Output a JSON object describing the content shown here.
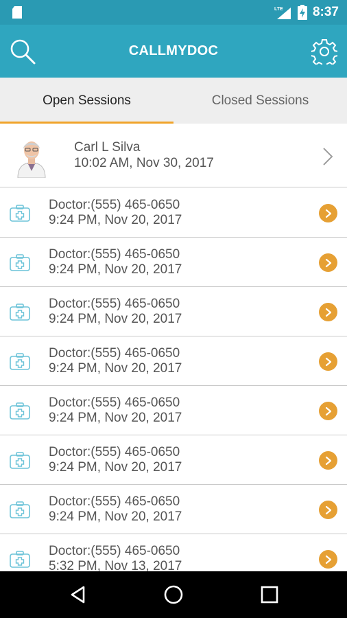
{
  "status_bar": {
    "time": "8:37",
    "network_label": "LTE",
    "icons": [
      "sd-card-icon",
      "lte-signal-icon",
      "battery-charging-icon"
    ],
    "background": "#2a9ab3"
  },
  "app_bar": {
    "title": "CALLMYDOC",
    "left_icon": "search-icon",
    "right_icon": "gear-icon",
    "background": "#2fa6bf"
  },
  "tabs": [
    {
      "label": "Open Sessions",
      "active": true
    },
    {
      "label": "Closed Sessions",
      "active": false
    }
  ],
  "accent": "#f0a32a",
  "profile": {
    "name": "Carl L Silva",
    "time": "10:02 AM, Nov 30, 2017",
    "icon": "chevron-right-icon"
  },
  "sessions": [
    {
      "doctor": "Doctor:(555) 465-0650",
      "time": "9:24 PM, Nov 20, 2017"
    },
    {
      "doctor": "Doctor:(555) 465-0650",
      "time": "9:24 PM, Nov 20, 2017"
    },
    {
      "doctor": "Doctor:(555) 465-0650",
      "time": "9:24 PM, Nov 20, 2017"
    },
    {
      "doctor": "Doctor:(555) 465-0650",
      "time": "9:24 PM, Nov 20, 2017"
    },
    {
      "doctor": "Doctor:(555) 465-0650",
      "time": "9:24 PM, Nov 20, 2017"
    },
    {
      "doctor": "Doctor:(555) 465-0650",
      "time": "9:24 PM, Nov 20, 2017"
    },
    {
      "doctor": "Doctor:(555) 465-0650",
      "time": "9:24 PM, Nov 20, 2017"
    },
    {
      "doctor": "Doctor:(555) 465-0650",
      "time": "5:32 PM, Nov 13, 2017"
    }
  ],
  "session_icons": {
    "left": "medical-kit-icon",
    "right": "arrow-right-circle-icon",
    "button_color": "#e6a034"
  },
  "nav_bar": {
    "icons": [
      "back-icon",
      "home-icon",
      "recents-icon"
    ]
  }
}
